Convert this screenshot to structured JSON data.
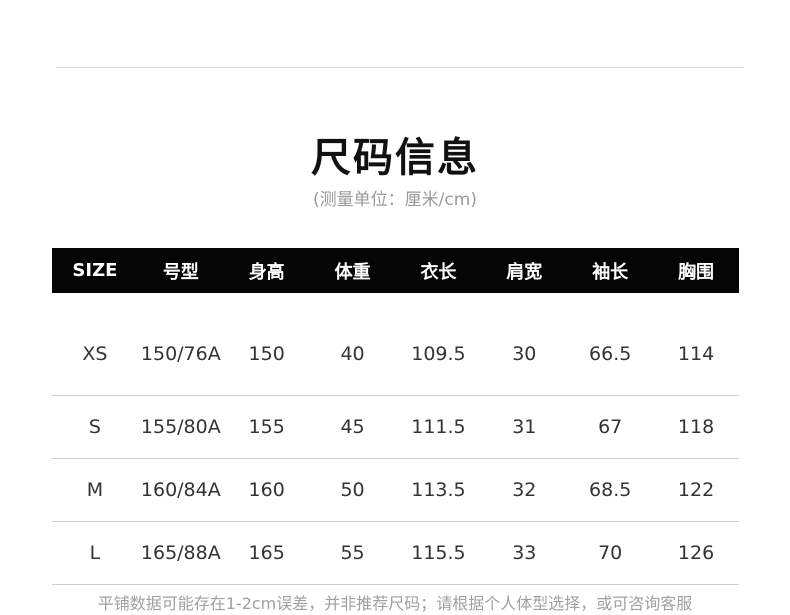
{
  "title": "尺码信息",
  "subtitle": "(测量单位：厘米/cm)",
  "table": {
    "headers": [
      "SIZE",
      "号型",
      "身高",
      "体重",
      "衣长",
      "肩宽",
      "袖长",
      "胸围"
    ],
    "rows": [
      [
        "XS",
        "150/76A",
        "150",
        "40",
        "109.5",
        "30",
        "66.5",
        "114"
      ],
      [
        "S",
        "155/80A",
        "155",
        "45",
        "111.5",
        "31",
        "67",
        "118"
      ],
      [
        "M",
        "160/84A",
        "160",
        "50",
        "113.5",
        "32",
        "68.5",
        "122"
      ],
      [
        "L",
        "165/88A",
        "165",
        "55",
        "115.5",
        "33",
        "70",
        "126"
      ]
    ]
  },
  "note": "平铺数据可能存在1-2cm误差，并非推荐尺码；请根据个人体型选择，或可咨询客服"
}
